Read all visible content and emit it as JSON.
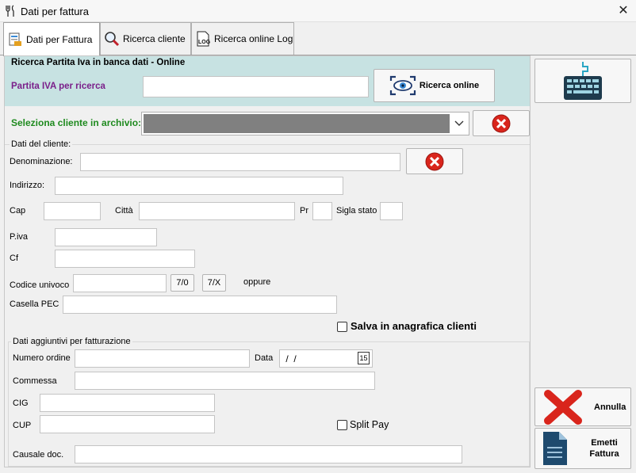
{
  "window": {
    "title": "Dati per fattura",
    "close_glyph": "✕",
    "title_icon": "fork-knife-icon"
  },
  "tabs": [
    {
      "label": "Dati per Fattura",
      "icon": "invoice-icon",
      "active": true
    },
    {
      "label": "Ricerca cliente",
      "icon": "magnifier-icon",
      "active": false
    },
    {
      "label": "Ricerca online Log",
      "icon": "log-icon",
      "active": false
    }
  ],
  "search_band": {
    "title": "Ricerca Partita Iva in banca dati - Online",
    "vat_label": "Partita IVA per ricerca",
    "vat_value": "",
    "search_button": "Ricerca online"
  },
  "client_select": {
    "label": "Seleziona cliente in archivio:",
    "value": ""
  },
  "client_data": {
    "group_title": "Dati del cliente:",
    "denominazione_label": "Denominazione:",
    "indirizzo_label": "Indirizzo:",
    "cap_label": "Cap",
    "citta_label": "Città",
    "pr_label": "Pr",
    "sigla_label": "Sigla stato",
    "piva_label": "P.iva",
    "cf_label": "Cf",
    "codice_label": "Codice univoco",
    "btn_7_0": "7/0",
    "btn_7_x": "7/X",
    "oppure_label": "oppure",
    "pec_label": "Casella PEC",
    "save_label": "Salva in anagrafica clienti"
  },
  "extra_data": {
    "group_title": "Dati aggiuntivi per fatturazione",
    "ordine_label": "Numero ordine",
    "data_label": "Data",
    "data_value": " /  /",
    "calendar_glyph": "15",
    "commessa_label": "Commessa",
    "cig_label": "CIG",
    "cup_label": "CUP",
    "split_label": "Split Pay",
    "causale_label": "Causale doc."
  },
  "side_buttons": {
    "keyboard_icon": "keyboard-icon",
    "annulla": "Annulla",
    "emetti": "Emetti Fattura"
  },
  "colors": {
    "band": "#c7e2e2",
    "purple": "#7a1f8a",
    "green": "#1e8a1e",
    "cancel_red": "#d9251c"
  }
}
